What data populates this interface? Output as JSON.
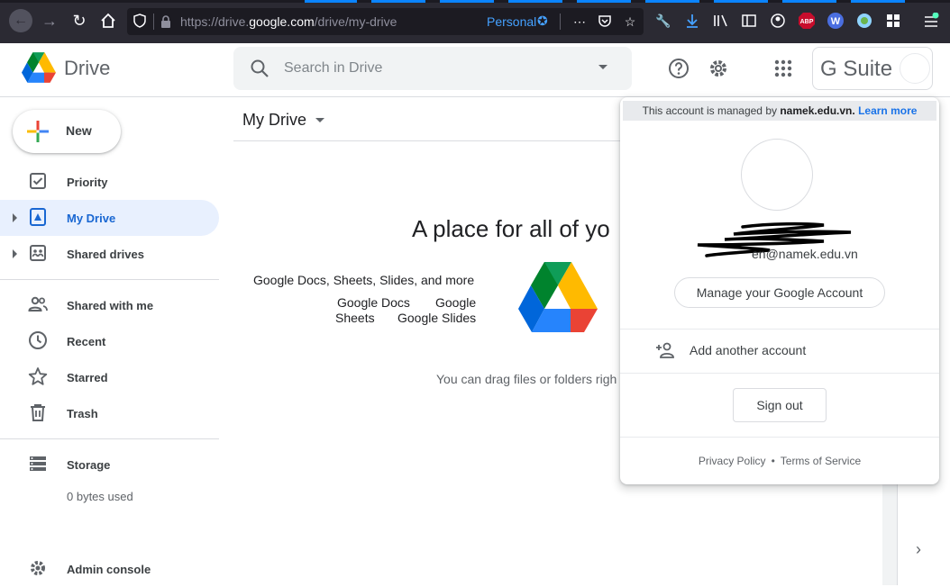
{
  "browser": {
    "url_prefix": "https://drive.",
    "url_domain": "google.com",
    "url_path": "/drive/my-drive",
    "container_label": "Personal"
  },
  "header": {
    "brand": "Drive",
    "search_placeholder": "Search in Drive",
    "gsuite_label": "G Suite"
  },
  "sidebar": {
    "new_label": "New",
    "items": [
      {
        "label": "Priority",
        "icon": "checkbox-icon"
      },
      {
        "label": "My Drive",
        "icon": "my-drive-icon",
        "active": true
      },
      {
        "label": "Shared drives",
        "icon": "shared-drives-icon"
      },
      {
        "label": "Shared with me",
        "icon": "people-icon"
      },
      {
        "label": "Recent",
        "icon": "clock-icon"
      },
      {
        "label": "Starred",
        "icon": "star-icon"
      },
      {
        "label": "Trash",
        "icon": "trash-icon"
      },
      {
        "label": "Storage",
        "icon": "storage-icon"
      },
      {
        "label": "Admin console",
        "icon": "admin-gear-icon"
      }
    ],
    "storage_used": "0 bytes used"
  },
  "main": {
    "title": "My Drive",
    "hero": "A place for all of yo",
    "features_heading": "Google Docs, Sheets, Slides, and more",
    "apps": [
      "Google Docs",
      "Google",
      "Sheets",
      "Google Slides"
    ],
    "drag_hint": "You can drag files or folders righ"
  },
  "account_popup": {
    "managed_prefix": "This account is managed by",
    "managed_domain": "namek.edu.vn.",
    "learn_more": "Learn more",
    "email_visible": "en@namek.edu.vn",
    "manage_button": "Manage your Google Account",
    "add_account": "Add another account",
    "sign_out": "Sign out",
    "privacy": "Privacy Policy",
    "dot": "•",
    "terms": "Terms of Service"
  },
  "colors": {
    "accent_blue": "#1a73e8",
    "active_nav_bg": "#e8f0fe",
    "firefox_toolbar": "#2b2a33"
  }
}
